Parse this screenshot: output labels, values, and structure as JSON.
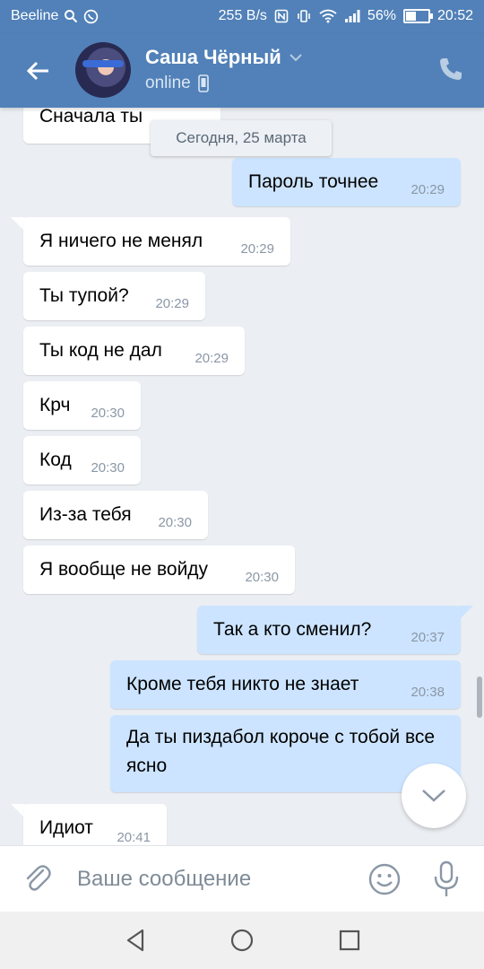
{
  "status_bar": {
    "carrier": "Beeline",
    "speed": "255 B/s",
    "battery": "56%",
    "battery_level": 0.56,
    "time": "20:52"
  },
  "header": {
    "contact_name": "Саша Чёрный",
    "contact_status": "online"
  },
  "chat": {
    "partial_top_message": "Сначала ты",
    "date_separator": "Сегодня, 25 марта",
    "messages": [
      {
        "dir": "out",
        "text": "Пароль точнее",
        "time": "20:29"
      },
      {
        "dir": "in",
        "text": "Я ничего не менял",
        "time": "20:29"
      },
      {
        "dir": "in",
        "text": "Ты тупой?",
        "time": "20:29"
      },
      {
        "dir": "in",
        "text": "Ты код не дал",
        "time": "20:29"
      },
      {
        "dir": "in",
        "text": "Крч",
        "time": "20:30"
      },
      {
        "dir": "in",
        "text": "Код",
        "time": "20:30"
      },
      {
        "dir": "in",
        "text": "Из-за тебя",
        "time": "20:30"
      },
      {
        "dir": "in",
        "text": "Я вообще не войду",
        "time": "20:30"
      },
      {
        "dir": "out",
        "text": "Так а кто сменил?",
        "time": "20:37"
      },
      {
        "dir": "out",
        "text": "Кроме тебя никто не знает",
        "time": "20:38"
      },
      {
        "dir": "out",
        "text": "Да ты пиздабол короче с тобой все ясно",
        "time": ""
      },
      {
        "dir": "in",
        "text": "Идиот",
        "time": "20:41"
      }
    ]
  },
  "composer": {
    "placeholder": "Ваше сообщение"
  },
  "colors": {
    "brand": "#5181b8",
    "outgoing_bubble": "#cce4ff",
    "incoming_bubble": "#ffffff",
    "background": "#ebeef2"
  },
  "icons": [
    "back-arrow-icon",
    "chevron-down-icon",
    "phone-device-icon",
    "phone-call-icon",
    "attach-icon",
    "emoji-icon",
    "microphone-icon",
    "scroll-down-icon",
    "nav-back-icon",
    "nav-home-icon",
    "nav-recents-icon"
  ]
}
